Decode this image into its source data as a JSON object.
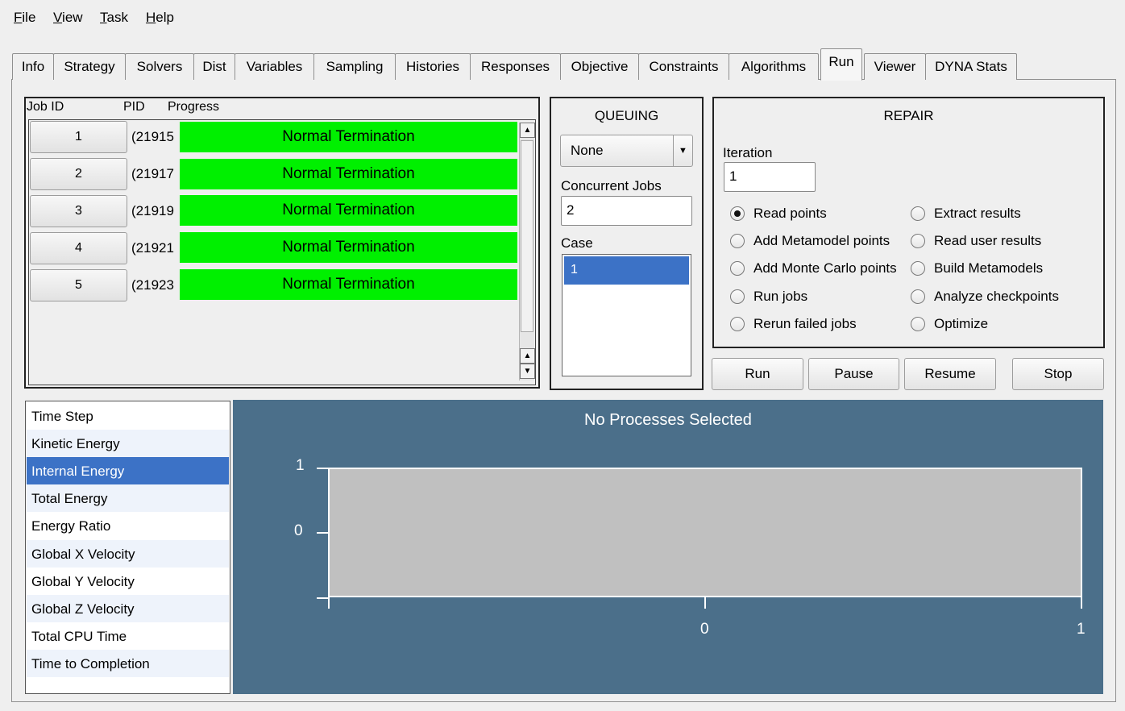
{
  "menu": {
    "file": "File",
    "view": "View",
    "task": "Task",
    "help": "Help"
  },
  "tabs": [
    "Info",
    "Strategy",
    "Solvers",
    "Dist",
    "Variables",
    "Sampling",
    "Histories",
    "Responses",
    "Objective",
    "Constraints",
    "Algorithms",
    "Run",
    "Viewer",
    "DYNA Stats"
  ],
  "active_tab": "Run",
  "jobs": {
    "headers": {
      "job_id": "Job ID",
      "pid": "PID",
      "progress": "Progress"
    },
    "rows": [
      {
        "id": "1",
        "pid": "(21915",
        "status": "Normal Termination"
      },
      {
        "id": "2",
        "pid": "(21917",
        "status": "Normal Termination"
      },
      {
        "id": "3",
        "pid": "(21919",
        "status": "Normal Termination"
      },
      {
        "id": "4",
        "pid": "(21921",
        "status": "Normal Termination"
      },
      {
        "id": "5",
        "pid": "(21923",
        "status": "Normal Termination"
      }
    ]
  },
  "queuing": {
    "title": "QUEUING",
    "queue_value": "None",
    "concurrent_label": "Concurrent Jobs",
    "concurrent_value": "2",
    "case_label": "Case",
    "cases": [
      "1"
    ]
  },
  "repair": {
    "title": "REPAIR",
    "iteration_label": "Iteration",
    "iteration_value": "1",
    "options_left": [
      "Read points",
      "Add Metamodel points",
      "Add Monte Carlo points",
      "Run jobs",
      "Rerun failed jobs"
    ],
    "options_right": [
      "Extract results",
      "Read user results",
      "Build Metamodels",
      "Analyze checkpoints",
      "Optimize"
    ],
    "selected": "Read points"
  },
  "actions": {
    "run": "Run",
    "pause": "Pause",
    "resume": "Resume",
    "stop": "Stop"
  },
  "variables": [
    "Time Step",
    "Kinetic Energy",
    "Internal Energy",
    "Total Energy",
    "Energy Ratio",
    "Global X Velocity",
    "Global Y Velocity",
    "Global Z Velocity",
    "Total CPU Time",
    "Time to Completion"
  ],
  "selected_variable": "Internal Energy",
  "chart_data": {
    "type": "line",
    "title": "No Processes Selected",
    "xlabel": "",
    "ylabel": "",
    "x_ticks": [
      "0",
      "1"
    ],
    "y_ticks": [
      "1",
      "0"
    ],
    "series": [],
    "colors": {
      "background": "#4b6f8a",
      "plot_area": "#c0c0c0"
    }
  }
}
